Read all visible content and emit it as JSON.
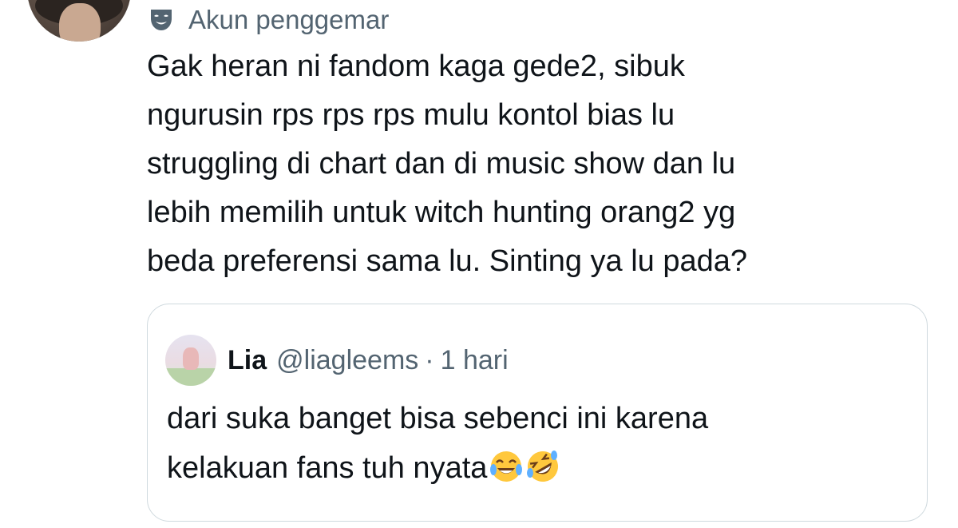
{
  "author": {
    "avatar_icon": "user-avatar-photo",
    "badge_icon": "mask-icon",
    "badge_label": "Akun penggemar"
  },
  "tweet": {
    "text": "Gak heran ni fandom kaga gede2, sibuk\nngurusin rps rps rps mulu kontol bias lu\nstruggling di chart dan di music show dan lu\nlebih memilih untuk witch hunting orang2 yg\nbeda preferensi sama lu. Sinting ya lu pada?"
  },
  "quoted_tweet": {
    "name": "Lia",
    "handle": "@liagleems",
    "separator": "·",
    "time": "1 hari",
    "text": "dari suka banget bisa sebenci ini karena\nkelakuan fans tuh nyata",
    "emojis": [
      "tears-of-joy-emoji",
      "rolling-on-floor-laughing-emoji"
    ]
  },
  "colors": {
    "primary_text": "#0f1419",
    "secondary_text": "#536471",
    "border": "#cfd9de"
  }
}
